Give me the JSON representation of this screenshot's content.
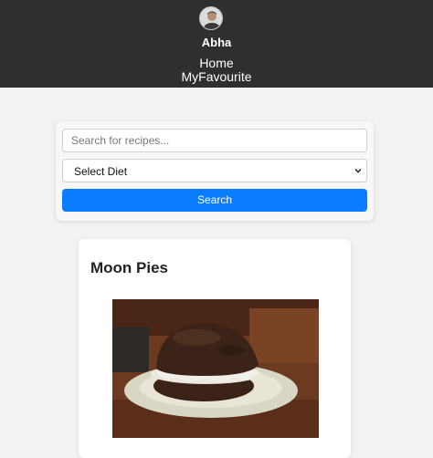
{
  "header": {
    "user_name": "Abha",
    "nav": [
      {
        "label": "Home"
      },
      {
        "label": "MyFavourite"
      }
    ]
  },
  "search": {
    "placeholder": "Search for recipes...",
    "diet_selected": "Select Diet",
    "button_label": "Search",
    "button_color": "#0a7cff"
  },
  "recipes": [
    {
      "title": "Moon Pies"
    }
  ],
  "colors": {
    "header_bg": "#2f2f2f",
    "page_bg": "#f2f2f2"
  }
}
